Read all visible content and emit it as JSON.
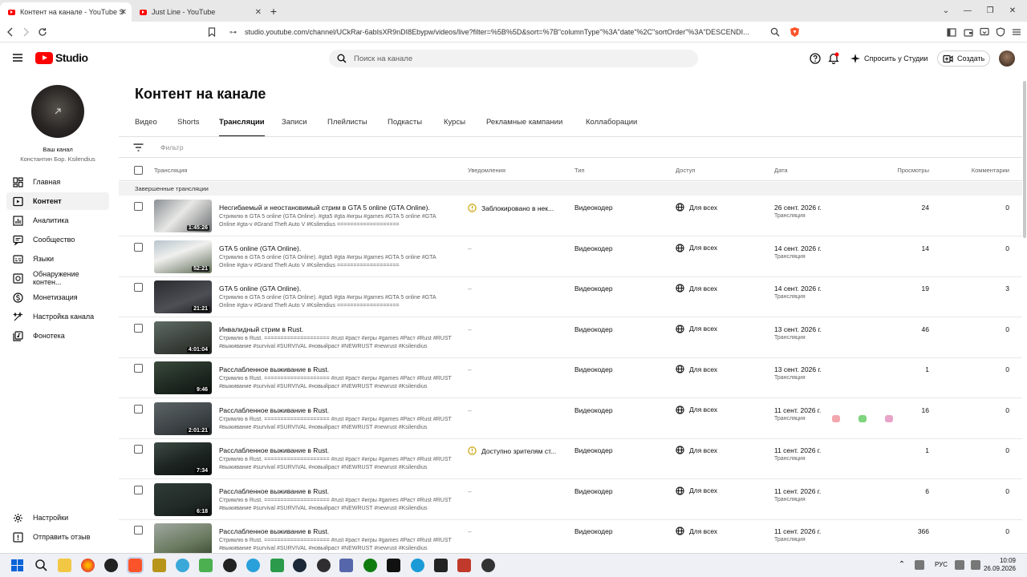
{
  "browser": {
    "tabs": [
      {
        "title": "Контент на канале - YouTube S",
        "active": true
      },
      {
        "title": "Just Line - YouTube",
        "active": false
      }
    ],
    "url": "studio.youtube.com/channel/UCkRar-6abIsXR9nDI8Ebypw/videos/live?filter=%5B%5D&sort=%7B\"columnType\"%3A\"date\"%2C\"sortOrder\"%3A\"DESCENDI..."
  },
  "header": {
    "logo_text": "Studio",
    "search_placeholder": "Поиск на канале",
    "ask_studio": "Спросить у Студии",
    "create": "Создать"
  },
  "sidebar": {
    "channel_label": "Ваш канал",
    "channel_name": "Константин Бор. Ksilendius",
    "items": [
      {
        "label": "Главная",
        "icon": "dashboard-icon"
      },
      {
        "label": "Контент",
        "icon": "content-icon",
        "active": true
      },
      {
        "label": "Аналитика",
        "icon": "analytics-icon"
      },
      {
        "label": "Сообщество",
        "icon": "community-icon"
      },
      {
        "label": "Языки",
        "icon": "subtitles-icon"
      },
      {
        "label": "Обнаружение контен...",
        "icon": "copyright-icon"
      },
      {
        "label": "Монетизация",
        "icon": "monetization-icon"
      },
      {
        "label": "Настройка канала",
        "icon": "customization-icon"
      },
      {
        "label": "Фонотека",
        "icon": "audio-library-icon"
      }
    ],
    "settings": "Настройки",
    "feedback": "Отправить отзыв"
  },
  "content": {
    "title": "Контент на канале",
    "tabs": [
      "Видео",
      "Shorts",
      "Трансляции",
      "Записи",
      "Плейлисты",
      "Подкасты",
      "Курсы",
      "Рекламные кампании",
      "Коллаборации"
    ],
    "active_tab": "Трансляции",
    "filter_placeholder": "Фильтр",
    "columns": {
      "stream": "Трансляция",
      "notifications": "Уведомления",
      "type": "Тип",
      "access": "Доступ",
      "date": "Дата",
      "views": "Просмотры",
      "comments": "Комментарии"
    },
    "section_label": "Завершенные трансляции",
    "rows": [
      {
        "title": "Несгибаемый и неостановимый стрим в GTA 5 online (GTA Online).",
        "desc": "Стримлю в GTA 5 online (GTA Online). #gta5 #gta #игры #games #GTA 5 online #GTA Online #gta-v #Grand Theft Auto V #Ksilendius ===================",
        "duration": "1:45:26",
        "restriction": "Заблокировано в нек...",
        "type": "Видеокодер",
        "visibility": "Для всех",
        "date": "26 сент. 2026 г.",
        "date_sub": "Трансляция",
        "views": "24",
        "comments": "0"
      },
      {
        "title": "GTA 5 online (GTA Online).",
        "desc": "Стримлю в GTA 5 online (GTA Online). #gta5 #gta #игры #games #GTA 5 online #GTA Online #gta-v #Grand Theft Auto V #Ksilendius ===================",
        "duration": "52:21",
        "restriction": "–",
        "type": "Видеокодер",
        "visibility": "Для всех",
        "date": "14 сент. 2026 г.",
        "date_sub": "Трансляция",
        "views": "14",
        "comments": "0"
      },
      {
        "title": "GTA 5 online (GTA Online).",
        "desc": "Стримлю в GTA 5 online (GTA Online). #gta5 #gta #игры #games #GTA 5 online #GTA Online #gta-v #Grand Theft Auto V #Ksilendius ===================",
        "duration": "21:21",
        "restriction": "–",
        "type": "Видеокодер",
        "visibility": "Для всех",
        "date": "14 сент. 2026 г.",
        "date_sub": "Трансляция",
        "views": "19",
        "comments": "3"
      },
      {
        "title": "Инвалидный стрим в Rust.",
        "desc": "Стримлю в Rust. ==================== #rust #раст #игры #games #Раст #Rust #RUST #выживание #survival #SURVIVAL #новыйраст #NEWRUST #newrust #Ksilendius",
        "duration": "4:01:04",
        "restriction": "–",
        "type": "Видеокодер",
        "visibility": "Для всех",
        "date": "13 сент. 2026 г.",
        "date_sub": "Трансляция",
        "views": "46",
        "comments": "0"
      },
      {
        "title": "Расслабленное выживание в Rust.",
        "desc": "Стримлю в Rust. ==================== #rust #раст #игры #games #Раст #Rust #RUST #выживание #survival #SURVIVAL #новыйраст #NEWRUST #newrust #Ksilendius",
        "duration": "9:46",
        "restriction": "–",
        "type": "Видеокодер",
        "visibility": "Для всех",
        "date": "13 сент. 2026 г.",
        "date_sub": "Трансляция",
        "views": "1",
        "comments": "0"
      },
      {
        "title": "Расслабленное выживание в Rust.",
        "desc": "Стримлю в Rust. ==================== #rust #раст #игры #games #Раст #Rust #RUST #выживание #survival #SURVIVAL #новыйраст #NEWRUST #newrust #Ksilendius",
        "duration": "2:01:21",
        "restriction": "–",
        "type": "Видеокодер",
        "visibility": "Для всех",
        "date": "11 сент. 2026 г.",
        "date_sub": "Трансляция",
        "views": "16",
        "comments": "0"
      },
      {
        "title": "Расслабленное выживание в Rust.",
        "desc": "Стримлю в Rust. ==================== #rust #раст #игры #games #Раст #Rust #RUST #выживание #survival #SURVIVAL #новыйраст #NEWRUST #newrust #Ksilendius",
        "duration": "7:34",
        "restriction": "Доступно зрителям ст...",
        "type": "Видеокодер",
        "visibility": "Для всех",
        "date": "11 сент. 2026 г.",
        "date_sub": "Трансляция",
        "views": "1",
        "comments": "0"
      },
      {
        "title": "Расслабленное выживание в Rust.",
        "desc": "Стримлю в Rust. ==================== #rust #раст #игры #games #Раст #Rust #RUST #выживание #survival #SURVIVAL #новыйраст #NEWRUST #newrust #Ksilendius",
        "duration": "6:18",
        "restriction": "–",
        "type": "Видеокодер",
        "visibility": "Для всех",
        "date": "11 сент. 2026 г.",
        "date_sub": "Трансляция",
        "views": "6",
        "comments": "0"
      },
      {
        "title": "Расслабленное выживание в Rust.",
        "desc": "Стримлю в Rust. ==================== #rust #раст #игры #games #Раст #Rust #RUST #выживание #survival #SURVIVAL #новыйраст #NEWRUST #newrust #Ksilendius",
        "duration": "",
        "restriction": "–",
        "type": "Видеокодер",
        "visibility": "Для всех",
        "date": "11 сент. 2026 г.",
        "date_sub": "Трансляция",
        "views": "366",
        "comments": "0"
      }
    ]
  },
  "taskbar": {
    "lang": "РУС",
    "time": "10:09",
    "date": "26.09.2026"
  },
  "colors": {
    "accent_red": "#ff0000",
    "warning_yellow": "#c9a100",
    "text_secondary": "#606060"
  }
}
